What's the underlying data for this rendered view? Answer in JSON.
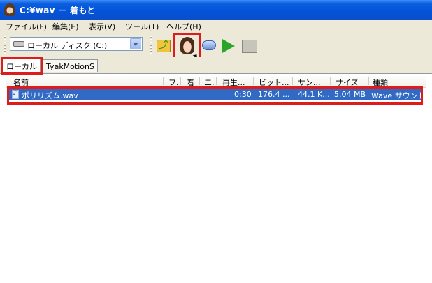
{
  "window": {
    "title": "C:¥wav － 着もと",
    "app_icon": "face-icon"
  },
  "menu": {
    "items": [
      "ファイル(F)",
      "編集(E)",
      "表示(V)",
      "ツール(T)",
      "ヘルプ(H)"
    ]
  },
  "toolbar": {
    "drive_label": "ローカル ディスク (C:)",
    "icons": [
      "folder-up-icon",
      "face-icon",
      "convert-icon",
      "play-icon",
      "stop-icon"
    ]
  },
  "tabs": [
    {
      "label": "ローカル",
      "active": true
    },
    {
      "label": "iTyakMotionS",
      "active": false
    }
  ],
  "list": {
    "columns": [
      "名前",
      "フ.",
      "着",
      "エ.",
      "再生...",
      "ビット...",
      "サン...",
      "サイズ",
      "種類"
    ],
    "rows": [
      {
        "name": "ポリリズム.wav",
        "duration": "0:30",
        "bitrate": "176.4 ...",
        "sample_rate": "44.1 K...",
        "size": "5.04 MB",
        "type": "Wave サウンド",
        "selected": true
      }
    ]
  },
  "colors": {
    "title_bar": "#0453d8",
    "selection": "#316ac5",
    "highlight_box": "#e01b1b"
  }
}
